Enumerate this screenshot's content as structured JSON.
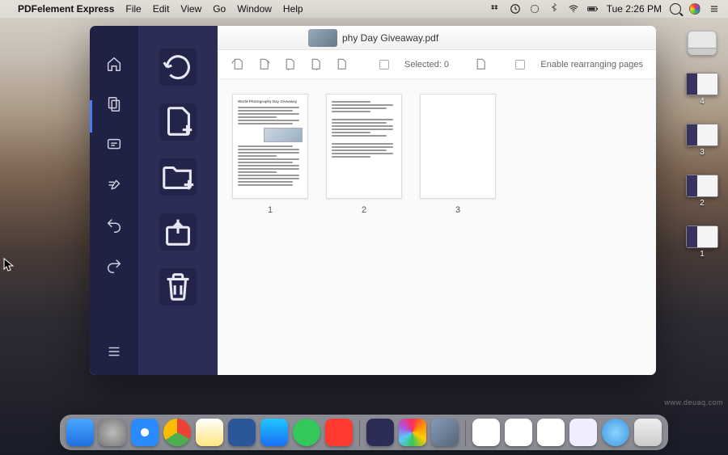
{
  "menubar": {
    "app": "PDFelement Express",
    "items": [
      "File",
      "Edit",
      "View",
      "Go",
      "Window",
      "Help"
    ],
    "battery_icon": "battery",
    "clock": "Tue 2:26 PM"
  },
  "desktop_thumbs": [
    "4",
    "3",
    "2",
    "1"
  ],
  "window": {
    "filename": "phy Day Giveaway.pdf",
    "toolbar": {
      "selected_label": "Selected: 0",
      "rearrange_label": "Enable rearranging pages"
    },
    "pages": [
      {
        "num": "1"
      },
      {
        "num": "2"
      },
      {
        "num": "3"
      }
    ]
  },
  "watermark": "www.deuaq.com"
}
